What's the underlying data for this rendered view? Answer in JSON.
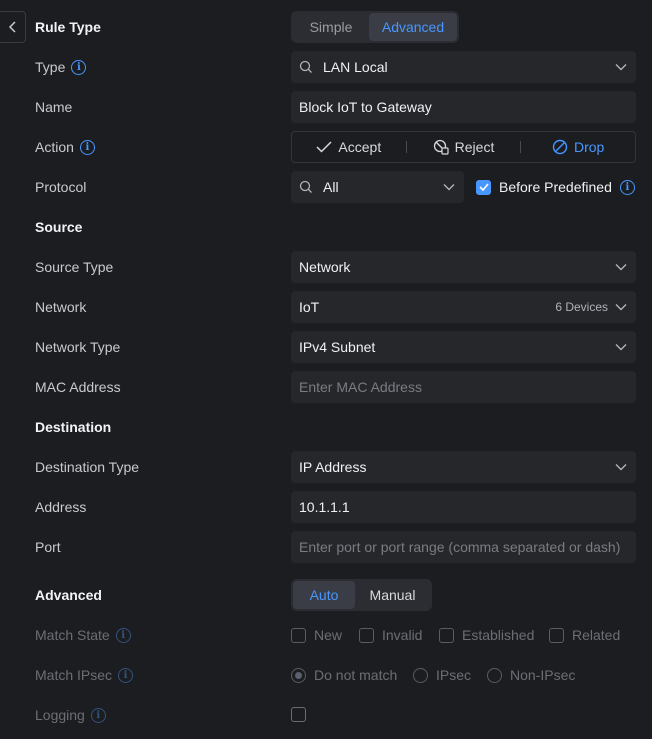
{
  "rule_type": {
    "label": "Rule Type",
    "options": [
      "Simple",
      "Advanced"
    ],
    "selected": "Advanced"
  },
  "type": {
    "label": "Type",
    "value": "LAN Local"
  },
  "name": {
    "label": "Name",
    "value": "Block IoT to Gateway"
  },
  "action": {
    "label": "Action",
    "options": [
      "Accept",
      "Reject",
      "Drop"
    ],
    "selected": "Drop"
  },
  "protocol": {
    "label": "Protocol",
    "value": "All",
    "before_predefined": "Before Predefined",
    "before_predefined_checked": true
  },
  "source": {
    "heading": "Source",
    "source_type": {
      "label": "Source Type",
      "value": "Network"
    },
    "network": {
      "label": "Network",
      "value": "IoT",
      "count": "6 Devices"
    },
    "network_type": {
      "label": "Network Type",
      "value": "IPv4 Subnet"
    },
    "mac": {
      "label": "MAC Address",
      "placeholder": "Enter MAC Address"
    }
  },
  "destination": {
    "heading": "Destination",
    "destination_type": {
      "label": "Destination Type",
      "value": "IP Address"
    },
    "address": {
      "label": "Address",
      "value": "10.1.1.1"
    },
    "port": {
      "label": "Port",
      "placeholder": "Enter port or port range (comma separated or dash)"
    }
  },
  "advanced": {
    "heading": "Advanced",
    "options": [
      "Auto",
      "Manual"
    ],
    "selected": "Auto",
    "match_state": {
      "label": "Match State",
      "options": [
        "New",
        "Invalid",
        "Established",
        "Related"
      ]
    },
    "match_ipsec": {
      "label": "Match IPsec",
      "options": [
        "Do not match",
        "IPsec",
        "Non-IPsec"
      ],
      "selected": "Do not match"
    },
    "logging": {
      "label": "Logging"
    }
  },
  "colors": {
    "accent": "#4797ff",
    "background": "#1c1d21",
    "field": "#26272b"
  }
}
